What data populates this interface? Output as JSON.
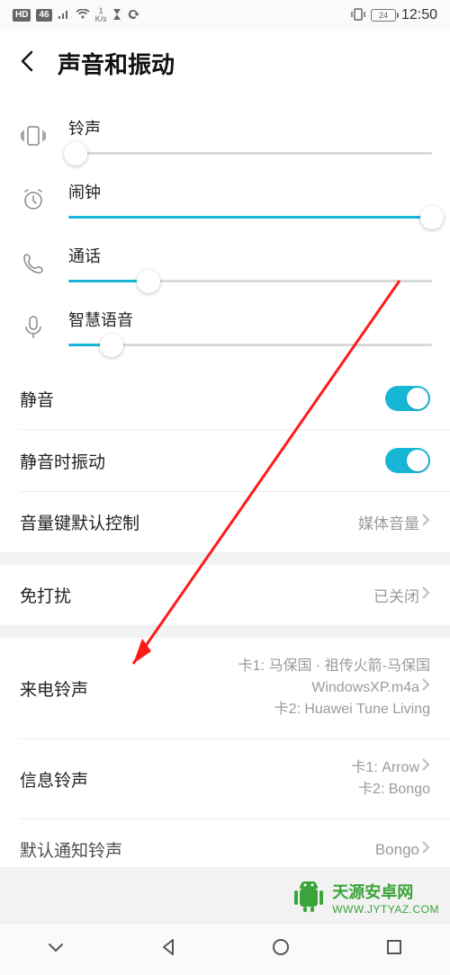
{
  "status": {
    "hd": "HD",
    "net": "46",
    "speed_top": "1",
    "speed_bottom": "K/s",
    "battery": "24",
    "time": "12:50"
  },
  "header": {
    "title": "声音和振动"
  },
  "sliders": [
    {
      "label": "铃声",
      "value_pct": 2
    },
    {
      "label": "闹钟",
      "value_pct": 100
    },
    {
      "label": "通话",
      "value_pct": 22
    },
    {
      "label": "智慧语音",
      "value_pct": 12
    }
  ],
  "rows": {
    "mute": {
      "label": "静音",
      "on": true
    },
    "vibrate_when_mute": {
      "label": "静音时振动",
      "on": true
    },
    "volume_key_default": {
      "label": "音量键默认控制",
      "value": "媒体音量"
    },
    "dnd": {
      "label": "免打扰",
      "value": "已关闭"
    },
    "ringtone": {
      "label": "来电铃声",
      "line1": "卡1: 马保国 · 祖传火箭-马保国",
      "line2": "WindowsXP.m4a",
      "line3": "卡2: Huawei Tune Living"
    },
    "message_tone": {
      "label": "信息铃声",
      "line1": "卡1: Arrow",
      "line2": "卡2: Bongo"
    },
    "default_notification": {
      "label": "默认通知铃声",
      "value": "Bongo"
    }
  },
  "watermark": {
    "main": "天源安卓网",
    "sub": "WWW.JYTYAZ.COM"
  }
}
